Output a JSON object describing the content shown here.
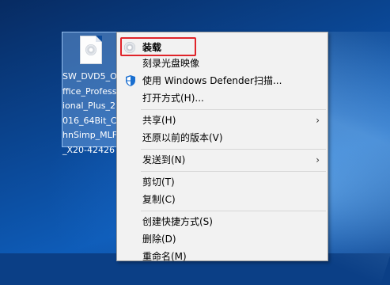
{
  "desktop": {
    "file_icon_name": "SW_DVD5_Office_Professional_Plus_2016_64Bit_ChnSimp_MLF_X20-42426"
  },
  "menu": {
    "items": [
      {
        "label": "装载",
        "icon": "disc-icon",
        "bold": true,
        "highlighted": true
      },
      {
        "label": "刻录光盘映像",
        "icon": "",
        "bold": false
      },
      {
        "label": "使用 Windows Defender扫描...",
        "icon": "defender-shield-icon",
        "bold": false
      },
      {
        "label": "打开方式(H)...",
        "icon": "",
        "bold": false
      },
      {
        "label": "共享(H)",
        "icon": "",
        "bold": false,
        "submenu": true
      },
      {
        "label": "还原以前的版本(V)",
        "icon": "",
        "bold": false
      },
      {
        "label": "发送到(N)",
        "icon": "",
        "bold": false,
        "submenu": true
      },
      {
        "label": "剪切(T)",
        "icon": "",
        "bold": false
      },
      {
        "label": "复制(C)",
        "icon": "",
        "bold": false
      },
      {
        "label": "创建快捷方式(S)",
        "icon": "",
        "bold": false
      },
      {
        "label": "删除(D)",
        "icon": "",
        "bold": false
      },
      {
        "label": "重命名(M)",
        "icon": "",
        "bold": false
      }
    ],
    "submenu_arrow": "›"
  },
  "colors": {
    "highlight_border": "#e0242a",
    "menu_bg": "#f2f2f2",
    "desktop_blue": "#0b4a9a"
  }
}
